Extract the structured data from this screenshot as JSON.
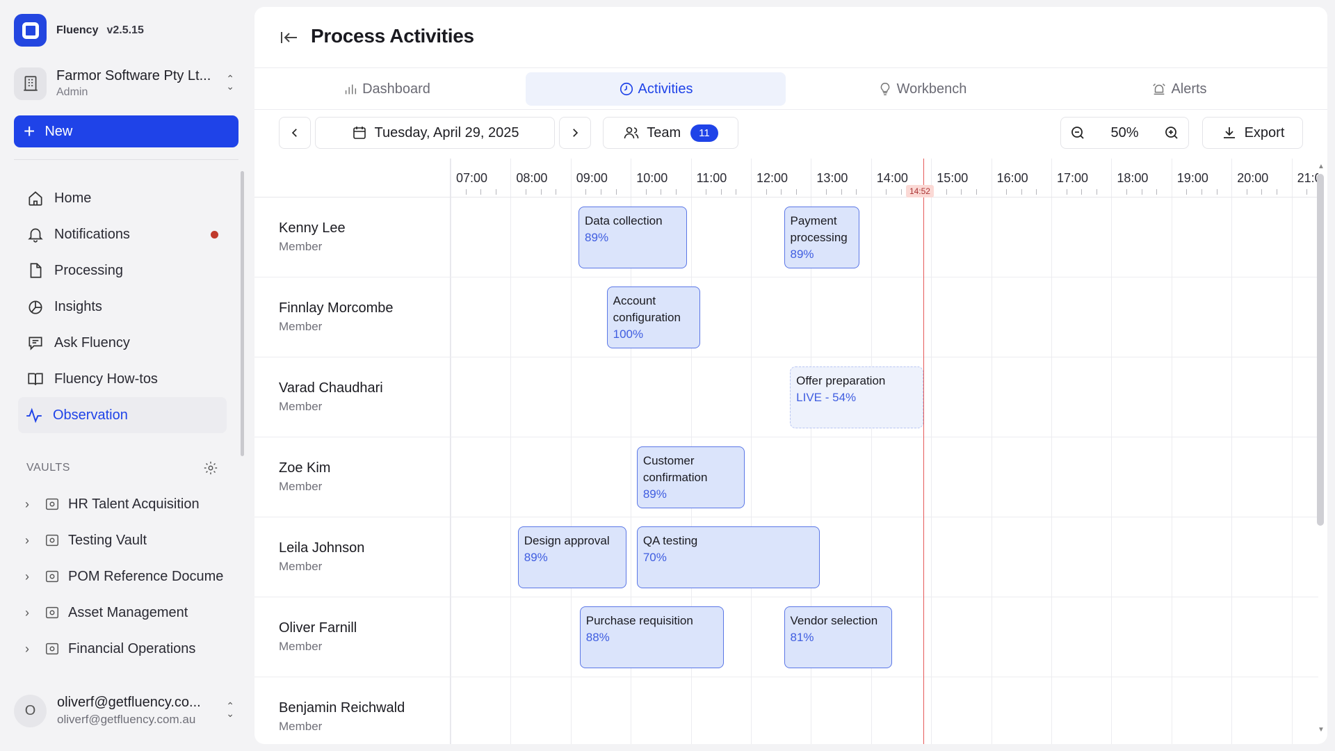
{
  "app": {
    "name": "Fluency",
    "version": "v2.5.15"
  },
  "org": {
    "name": "Farmor Software Pty Lt...",
    "role": "Admin"
  },
  "new_button": "New",
  "nav": [
    {
      "label": "Home",
      "icon": "home-icon"
    },
    {
      "label": "Notifications",
      "icon": "bell-icon",
      "dot": true
    },
    {
      "label": "Processing",
      "icon": "file-icon"
    },
    {
      "label": "Insights",
      "icon": "pie-chart-icon"
    },
    {
      "label": "Ask Fluency",
      "icon": "chat-icon"
    },
    {
      "label": "Fluency How-tos",
      "icon": "book-icon"
    },
    {
      "label": "Observation",
      "icon": "activity-icon",
      "active": true
    }
  ],
  "vaults": {
    "title": "VAULTS",
    "items": [
      "HR Talent Acquisition",
      "Testing Vault",
      "POM Reference Docume",
      "Asset Management",
      "Financial Operations"
    ]
  },
  "user": {
    "name": "oliverf@getfluency.co...",
    "email": "oliverf@getfluency.com.au",
    "initial": "O"
  },
  "header": {
    "title": "Process Activities"
  },
  "tabs": [
    {
      "label": "Dashboard",
      "icon": "bar-chart-icon"
    },
    {
      "label": "Activities",
      "icon": "clock-icon",
      "active": true
    },
    {
      "label": "Workbench",
      "icon": "lightbulb-icon"
    },
    {
      "label": "Alerts",
      "icon": "alarm-icon"
    }
  ],
  "toolbar": {
    "date": "Tuesday, April 29, 2025",
    "team_label": "Team",
    "team_count": "11",
    "zoom": "50%",
    "export_label": "Export"
  },
  "timeline": {
    "hours": [
      "07:00",
      "08:00",
      "09:00",
      "10:00",
      "11:00",
      "12:00",
      "13:00",
      "14:00",
      "15:00",
      "16:00",
      "17:00",
      "18:00",
      "19:00",
      "20:00",
      "21:00"
    ],
    "now": "14:52",
    "now_hours": 14.87
  },
  "members": [
    {
      "name": "Kenny Lee",
      "role": "Member",
      "activities": [
        {
          "name": "Data collection",
          "progress": "89%",
          "start": 9.13,
          "end": 10.93
        },
        {
          "name": "Payment processing",
          "progress": "89%",
          "start": 12.55,
          "end": 13.8
        }
      ]
    },
    {
      "name": "Finnlay Morcombe",
      "role": "Member",
      "activities": [
        {
          "name": "Account configuration",
          "progress": "100%",
          "start": 9.6,
          "end": 11.16
        }
      ]
    },
    {
      "name": "Varad Chaudhari",
      "role": "Member",
      "activities": [
        {
          "name": "Offer preparation",
          "progress": "LIVE - 54%",
          "start": 12.65,
          "end": 14.87,
          "live": true
        }
      ]
    },
    {
      "name": "Zoe Kim",
      "role": "Member",
      "activities": [
        {
          "name": "Customer confirmation",
          "progress": "89%",
          "start": 10.1,
          "end": 11.9
        }
      ]
    },
    {
      "name": "Leila Johnson",
      "role": "Member",
      "activities": [
        {
          "name": "Design approval",
          "progress": "89%",
          "start": 8.12,
          "end": 9.93
        },
        {
          "name": "QA testing",
          "progress": "70%",
          "start": 10.1,
          "end": 13.15
        }
      ]
    },
    {
      "name": "Oliver Farnill",
      "role": "Member",
      "activities": [
        {
          "name": "Purchase requisition",
          "progress": "88%",
          "start": 9.15,
          "end": 11.55
        },
        {
          "name": "Vendor selection",
          "progress": "81%",
          "start": 12.55,
          "end": 14.35
        }
      ]
    },
    {
      "name": "Benjamin Reichwald",
      "role": "Member",
      "activities": []
    }
  ]
}
